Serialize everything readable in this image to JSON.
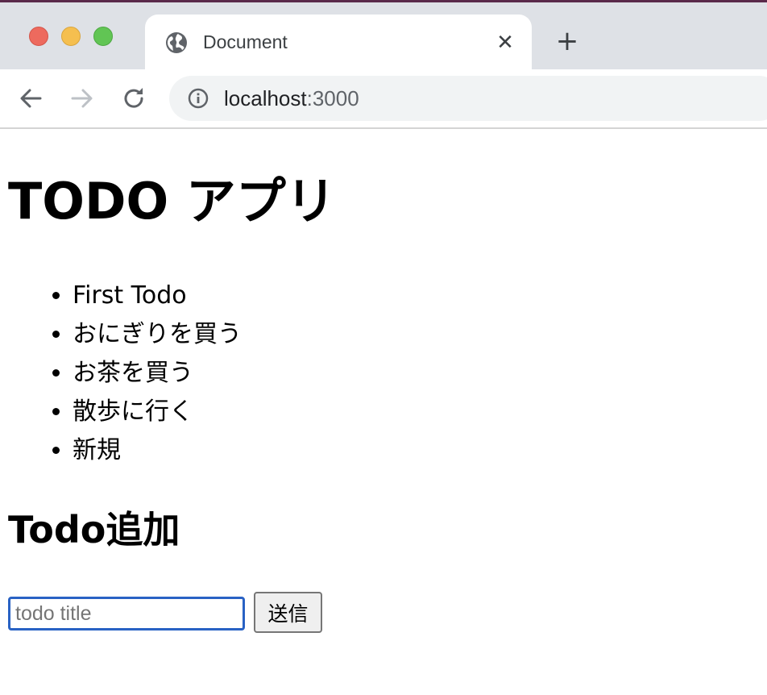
{
  "browser": {
    "tab": {
      "title": "Document",
      "favicon": "globe-icon",
      "close_icon": "close-icon"
    },
    "new_tab_icon": "plus-icon",
    "nav": {
      "back_icon": "arrow-left-icon",
      "forward_icon": "arrow-right-icon",
      "reload_icon": "reload-icon"
    },
    "address": {
      "info_icon": "info-icon",
      "host": "localhost",
      "port": ":3000"
    }
  },
  "page": {
    "title": "TODO アプリ",
    "todos": [
      "First Todo",
      "おにぎりを買う",
      "お茶を買う",
      "散歩に行く",
      "新規"
    ],
    "add_section_title": "Todo追加",
    "input": {
      "placeholder": "todo title",
      "value": ""
    },
    "submit_label": "送信"
  },
  "colors": {
    "tabstrip_bg": "#dee1e6",
    "omnibox_bg": "#f1f3f4",
    "input_focus_border": "#2962c4",
    "traffic_red": "#ed6a5e",
    "traffic_yellow": "#f5bf4f",
    "traffic_green": "#61c554"
  }
}
